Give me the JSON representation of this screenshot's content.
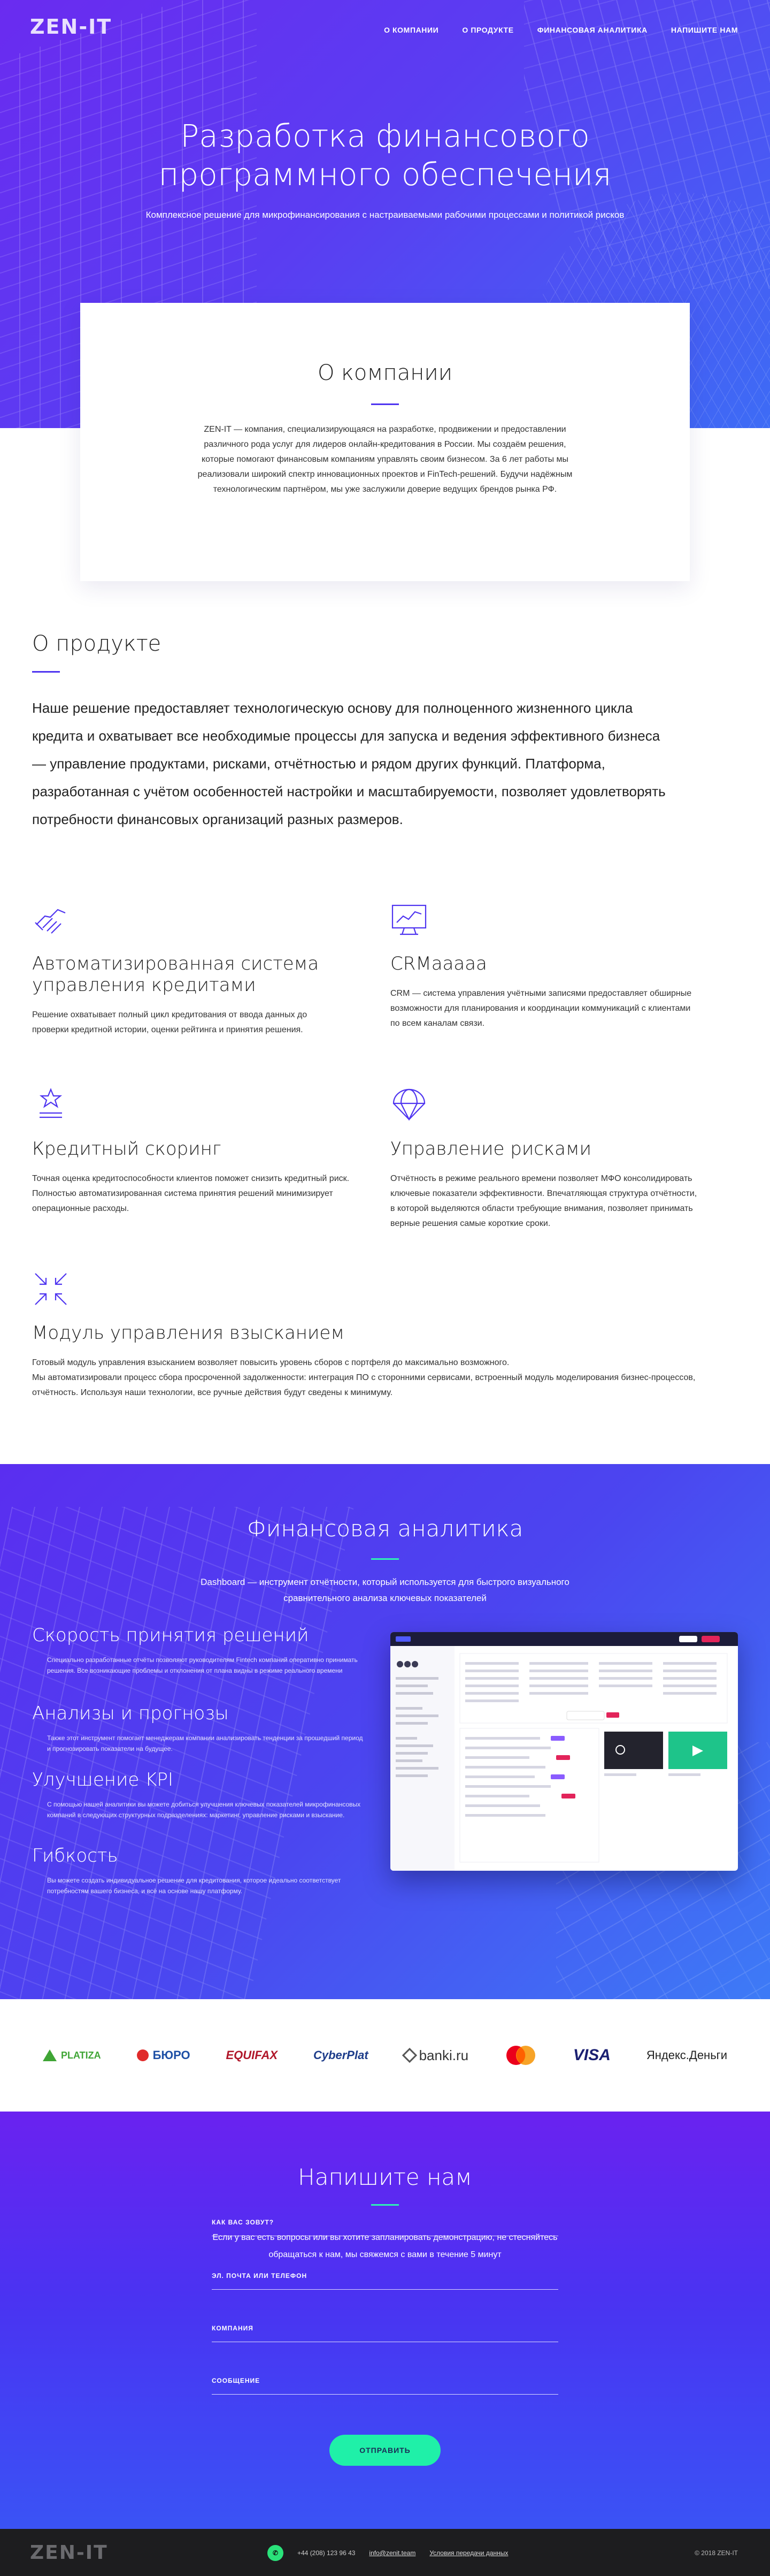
{
  "header": {
    "logo": "ZEN-IT",
    "nav": [
      "О компании",
      "О продукте",
      "Финансовая аналитика",
      "Напишите нам"
    ]
  },
  "hero": {
    "title_line1": "Разработка финансового",
    "title_line2": "программного обеспечения",
    "subtitle": "Комплексное решение для микрофинансирования с настраиваемыми рабочими процессами и политикой рисков"
  },
  "about": {
    "title": "О компании",
    "text": "ZEN-IT — компания, специализирующаяся на разработке, продвижении и предоставлении различного рода услуг для лидеров онлайн-кредитования в России. Мы создаём решения, которые помогают финансовым компаниям управлять своим бизнесом. За 6 лет работы мы реализовали широкий спектр инновационных проектов и FinTech-решений. Будучи надёжным технологическим партнёром, мы уже заслужили доверие ведущих брендов рынка РФ."
  },
  "product": {
    "title": "О продукте",
    "lead": "Наше решение предоставляет технологическую основу для полноценного жизненного цикла кредита и охватывает все необходимые процессы для запуска и ведения эффективного бизнеса — управление продуктами, рисками, отчётностью и рядом других функций. Платформа, разработанная с учётом особенностей настройки и масштабируемости, позволяет удовлетворять потребности финансовых организаций разных размеров.",
    "features": [
      {
        "icon": "handshake-icon",
        "title": "Автоматизированная система управления кредитами",
        "text": "Решение охватывает полный цикл кредитования от ввода данных до проверки кредитной истории, оценки рейтинга и принятия решения."
      },
      {
        "icon": "chart-monitor-icon",
        "title": "CRMaaaaa",
        "text": "CRM — система управления учётными записями предоставляет обширные возможности для планирования и координации коммуникаций с клиентами по всем каналам связи."
      },
      {
        "icon": "star-award-icon",
        "title": "Кредитный скоринг",
        "text": "Точная оценка кредитоспособности клиентов поможет снизить кредитный риск. Полностью автоматизированная система принятия решений минимизирует операционные расходы."
      },
      {
        "icon": "parachute-icon",
        "title": "Управление рисками",
        "text": "Отчётность в режиме реального времени позволяет МФО консолидировать ключевые показатели эффективности. Впечатляющая структура отчётности, в которой выделяются области требующие внимания, позволяет принимать верные решения самые короткие сроки."
      },
      {
        "icon": "collect-arrows-icon",
        "title": "Модуль управления взысканием",
        "text1": "Готовый модуль управления взысканием возволяет повысить уровень сборов с портфеля до максимально возможного.",
        "text2": "Мы автоматизировали процесс сбора просроченной задолженности: интеграция ПО с сторонними сервисами, встроенный модуль моделирования бизнес-процессов, отчётность. Используя наши технологии, все ручные действия будут сведены к минимуму."
      }
    ]
  },
  "analytics": {
    "title": "Финансовая аналитика",
    "desc": "Dashboard — инструмент отчётности, который используется для быстрого визуального сравнительного анализа ключевых показателей",
    "blocks": [
      {
        "title": "Скорость принятия решений",
        "text": "Специально разработанные отчёты позволяют руководителям Fintech компаний оперативно принимать решения. Все возникающие проблемы и отклонения от плана видны в режиме реального времени"
      },
      {
        "title": "Анализы и прогнозы",
        "text": "Также этот инструмент помогает менеджерам компании анализировать тенденции за прошедший период и прогнозировать показатели на будущее."
      },
      {
        "title": "Улучшение KPI",
        "text": "С помощью нашей аналитики вы можете добиться улучшения ключевых показателей микрофинансовых компаний в следующих структурных подразделениях: маркетинг, управление рисками и взыскание."
      },
      {
        "title": "Гибкость",
        "text": "Вы можете создать индивидуальное решение для кредитования, которое идеально соответствует потребностям вашего бизнеса, и всё на основе нашу платформу."
      }
    ]
  },
  "partners": [
    "PLATIZA",
    "БЮРО",
    "EQUIFAX",
    "CyberPlat",
    "banki.ru",
    "mastercard",
    "VISA",
    "Яндекс.Деньги"
  ],
  "contact": {
    "title": "Напишите нам",
    "desc": "Если у вас есть вопросы или вы хотите запланировать демонстрацию, не стесняйтесь обращаться к нам, мы свяжемся с вами в течение 5 минут",
    "fields": [
      "Как вас зовут?",
      "Эл. почта или телефон",
      "Компания",
      "Сообщение"
    ],
    "submit": "Отправить"
  },
  "footer": {
    "logo": "ZEN-IT",
    "phone": "+44 (208) 123 96 43",
    "email": "info@zenit.team",
    "terms": "Условия передачи данных",
    "copyright": "© 2018 ZEN-IT"
  },
  "colors": {
    "accent": "#4f35f0",
    "mint": "#1ff0a8",
    "footer": "#1d1d1f"
  }
}
